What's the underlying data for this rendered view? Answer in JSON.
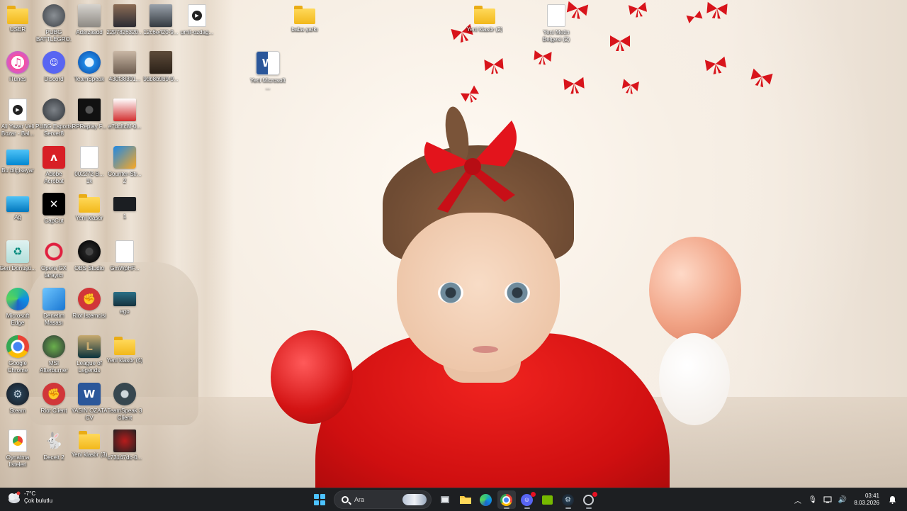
{
  "desktop": {
    "icons": [
      {
        "label": "USER",
        "icon": "folder-icon"
      },
      {
        "label": "PUBG BATTLEGRO...",
        "icon": "pubg-icon"
      },
      {
        "label": "Adsızasdd",
        "icon": "image-thumb-icon"
      },
      {
        "label": "2297826320...",
        "icon": "photo-thumb-icon"
      },
      {
        "label": "12c6e420-9...",
        "icon": "photo-thumb-icon"
      },
      {
        "label": "umit-ozdag...",
        "icon": "video-file-icon"
      },
      {
        "label": "iTunes",
        "icon": "itunes-icon"
      },
      {
        "label": "Discord",
        "icon": "discord-icon"
      },
      {
        "label": "TeamSpeak",
        "icon": "teamspeak-icon"
      },
      {
        "label": "430f38391...",
        "icon": "photo-thumb-icon"
      },
      {
        "label": "9db8b9b9-9...",
        "icon": "photo-thumb-icon"
      },
      {
        "label": "Ali Yazar Veli Bozar - Bal...",
        "icon": "video-file-icon"
      },
      {
        "label": "PUBG Esports Server8",
        "icon": "pubg-esports-icon"
      },
      {
        "label": "RPReplay F...",
        "icon": "video-thumb-icon"
      },
      {
        "label": "e7dc8c8f-0...",
        "icon": "photo-thumb-icon"
      },
      {
        "label": "Bu bilgisayar",
        "icon": "computer-icon"
      },
      {
        "label": "Adobe Acrobat",
        "icon": "acrobat-icon"
      },
      {
        "label": "002272-B... 1k",
        "icon": "document-icon"
      },
      {
        "label": "Counter-Str... 2",
        "icon": "cs2-icon"
      },
      {
        "label": "Ağ",
        "icon": "network-icon"
      },
      {
        "label": "CapCut",
        "icon": "capcut-icon"
      },
      {
        "label": "Yeni klasör",
        "icon": "folder-icon"
      },
      {
        "label": "1",
        "icon": "image-thumb-icon"
      },
      {
        "label": "Geri Dönüşü...",
        "icon": "recycle-bin-icon"
      },
      {
        "label": "Opera GX tarayıcı",
        "icon": "opera-gx-icon"
      },
      {
        "label": "OBS Studio",
        "icon": "obs-icon"
      },
      {
        "label": "GmWpHF...",
        "icon": "document-icon"
      },
      {
        "label": "Microsoft Edge",
        "icon": "edge-icon"
      },
      {
        "label": "Denetim Masası",
        "icon": "control-panel-icon"
      },
      {
        "label": "Riot İstemcisi",
        "icon": "riot-icon"
      },
      {
        "label": "ego",
        "icon": "image-thumb-icon"
      },
      {
        "label": "Google Chrome",
        "icon": "chrome-icon"
      },
      {
        "label": "MSI Afterburner",
        "icon": "afterburner-icon"
      },
      {
        "label": "League of Legends",
        "icon": "lol-icon"
      },
      {
        "label": "Yeni klasör (4)",
        "icon": "folder-icon"
      },
      {
        "label": "Steam",
        "icon": "steam-icon"
      },
      {
        "label": "Riot Client",
        "icon": "riot-icon"
      },
      {
        "label": "YASIN OZATA CV",
        "icon": "word-icon"
      },
      {
        "label": "TeamSpeak 3 Client",
        "icon": "teamspeak-icon"
      },
      {
        "label": "Oynatma listeleri",
        "icon": "chrome-icon"
      },
      {
        "label": "Deceit 2",
        "icon": "deceit-icon"
      },
      {
        "label": "Yeni klasör (3)",
        "icon": "folder-icon"
      },
      {
        "label": "c73147dc-0...",
        "icon": "photo-thumb-icon"
      },
      {
        "label": "Yeni Microsoft ...",
        "icon": "word-icon"
      },
      {
        "label": "baba şarkı",
        "icon": "folder-icon"
      },
      {
        "label": "Yeni klasör (2)",
        "icon": "folder-icon"
      },
      {
        "label": "Yeni Metin Belgesi (2)",
        "icon": "text-file-icon"
      }
    ]
  },
  "taskbar": {
    "weather": {
      "temp": "-7°C",
      "condition": "Çok bulutlu",
      "icon": "weather-cloud-icon"
    },
    "search_placeholder": "Ara",
    "apps": [
      {
        "name": "start",
        "icon": "windows-start-icon"
      },
      {
        "name": "task-view",
        "icon": "task-view-icon"
      },
      {
        "name": "file-explorer",
        "icon": "folder-icon"
      },
      {
        "name": "edge",
        "icon": "edge-icon"
      },
      {
        "name": "chrome",
        "icon": "chrome-icon"
      },
      {
        "name": "discord",
        "icon": "discord-icon"
      },
      {
        "name": "nvidia",
        "icon": "nvidia-icon"
      },
      {
        "name": "steam",
        "icon": "steam-icon"
      },
      {
        "name": "rockstar",
        "icon": "settings-app-icon"
      }
    ],
    "clock": {
      "time": "03:41",
      "date": "8.03.2026"
    },
    "colors": {
      "taskbar_bg": "#1d1f22",
      "accent": "#4cc2ff"
    }
  }
}
